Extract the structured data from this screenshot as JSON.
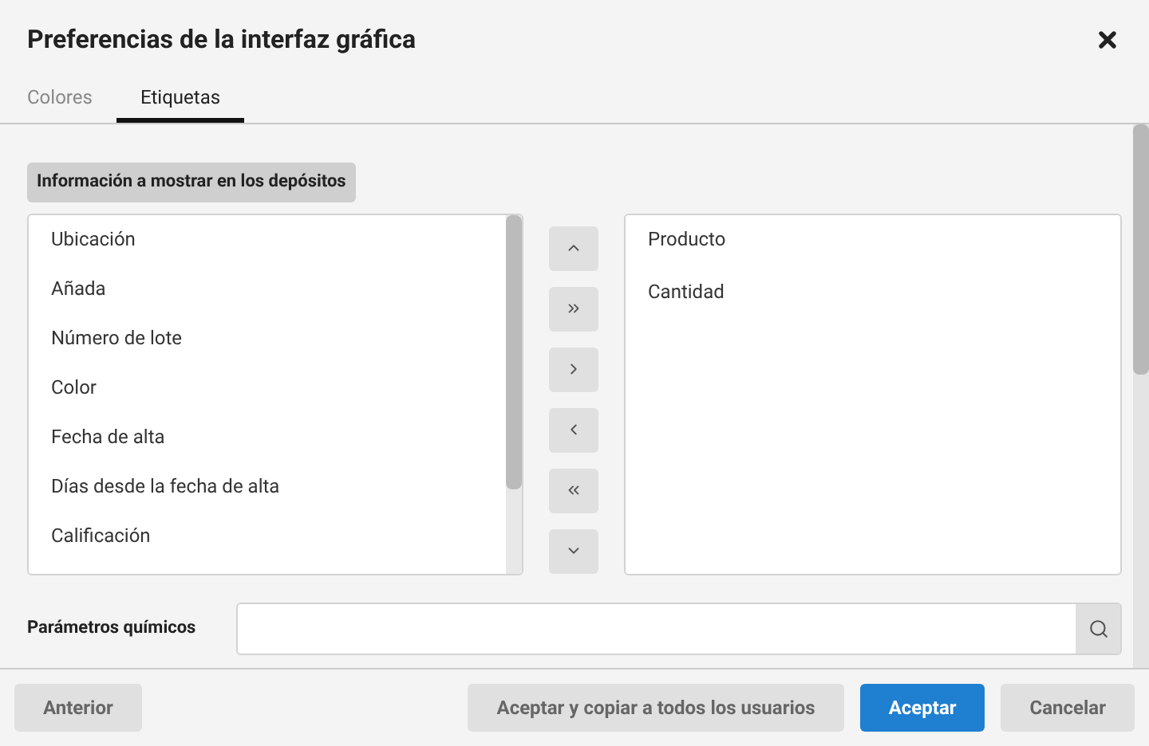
{
  "dialog": {
    "title": "Preferencias de la interfaz gráfica"
  },
  "tabs": [
    {
      "label": "Colores",
      "selected": false
    },
    {
      "label": "Etiquetas",
      "selected": true
    }
  ],
  "section": {
    "title": "Información a mostrar en los depósitos"
  },
  "available_list": [
    "Ubicación",
    "Añada",
    "Número de lote",
    "Color",
    "Fecha de alta",
    "Días desde la fecha de alta",
    "Calificación"
  ],
  "transfer_buttons": [
    {
      "kind": "up"
    },
    {
      "kind": "add_all"
    },
    {
      "kind": "add"
    },
    {
      "kind": "remove"
    },
    {
      "kind": "remove_all"
    },
    {
      "kind": "down"
    }
  ],
  "selected_list": [
    "Producto",
    "Cantidad"
  ],
  "chemical_params": {
    "label": "Parámetros químicos"
  },
  "footer_buttons": [
    {
      "label": "Anterior",
      "kind": "secondary"
    },
    {
      "label": "Aceptar y copiar a todos los usuarios",
      "kind": "secondary"
    },
    {
      "label": "Aceptar",
      "kind": "primary"
    },
    {
      "label": "Cancelar",
      "kind": "secondary"
    }
  ]
}
